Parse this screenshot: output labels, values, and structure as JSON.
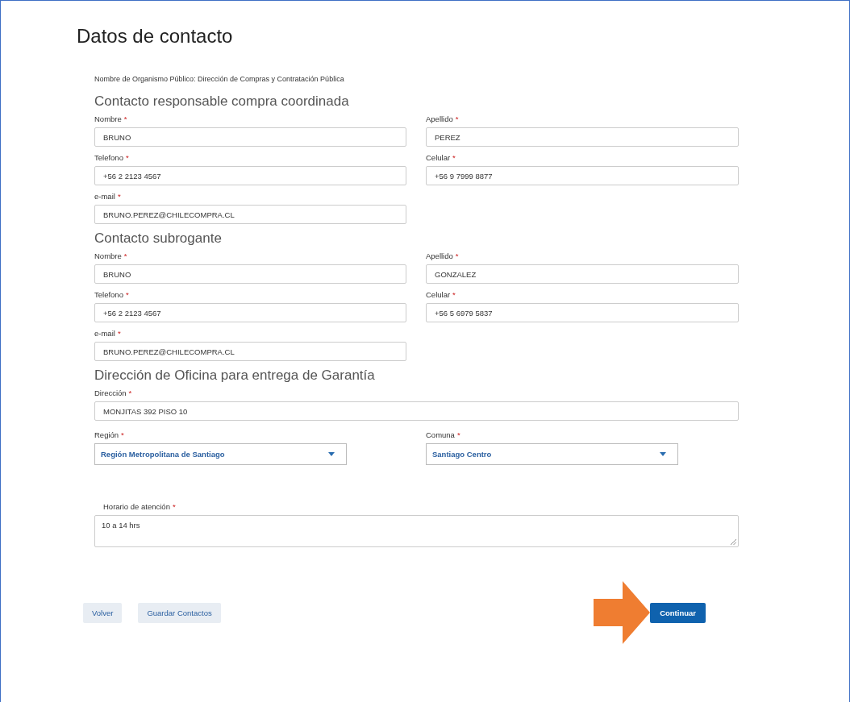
{
  "title": "Datos de contacto",
  "organism": "Nombre de Organismo Público: Dirección de Compras y Contratación Pública",
  "sections": [
    {
      "heading": "Contacto responsable compra coordinada",
      "fields": [
        {
          "kind": "text",
          "label": "Nombre",
          "required_mark": "*",
          "value": "BRUNO"
        },
        {
          "kind": "text",
          "label": "Apellido",
          "required_mark": "*",
          "value": "PEREZ"
        },
        {
          "kind": "text",
          "label": "Telefono",
          "required_mark": "*",
          "value": "+56 2 2123 4567"
        },
        {
          "kind": "text",
          "label": "Celular",
          "required_mark": "*",
          "value": "+56 9 7999 8877"
        },
        {
          "kind": "text",
          "label": "e-mail",
          "required_mark": "*",
          "value": "BRUNO.PEREZ@CHILECOMPRA.CL"
        }
      ]
    },
    {
      "heading": "Contacto subrogante",
      "fields": [
        {
          "kind": "text",
          "label": "Nombre",
          "required_mark": "*",
          "value": "BRUNO"
        },
        {
          "kind": "text",
          "label": "Apellido",
          "required_mark": "*",
          "value": "GONZALEZ"
        },
        {
          "kind": "text",
          "label": "Telefono",
          "required_mark": "*",
          "value": "+56 2 2123 4567"
        },
        {
          "kind": "text",
          "label": "Celular",
          "required_mark": "*",
          "value": "+56 5 6979 5837"
        },
        {
          "kind": "text",
          "label": "e-mail",
          "required_mark": "*",
          "value": "BRUNO.PEREZ@CHILECOMPRA.CL"
        }
      ]
    },
    {
      "heading": "Dirección de Oficina para entrega de Garantía",
      "fields": [
        {
          "kind": "wide",
          "label": "Dirección",
          "required_mark": "*",
          "value": "MONJITAS 392 PISO 10"
        },
        {
          "kind": "select",
          "label": "Región",
          "required_mark": "*",
          "value": "Región Metropolitana de Santiago"
        },
        {
          "kind": "select",
          "label": "Comuna",
          "required_mark": "*",
          "value": "Santiago Centro"
        },
        {
          "kind": "textarea",
          "label": "Horario de atención",
          "required_mark": "*",
          "value": "10 a 14 hrs"
        }
      ]
    }
  ],
  "buttons": [
    {
      "kind": "secondary",
      "label": "Volver"
    },
    {
      "kind": "secondary",
      "label": "Guardar Contactos"
    },
    {
      "kind": "primary",
      "label": "Continuar"
    }
  ]
}
